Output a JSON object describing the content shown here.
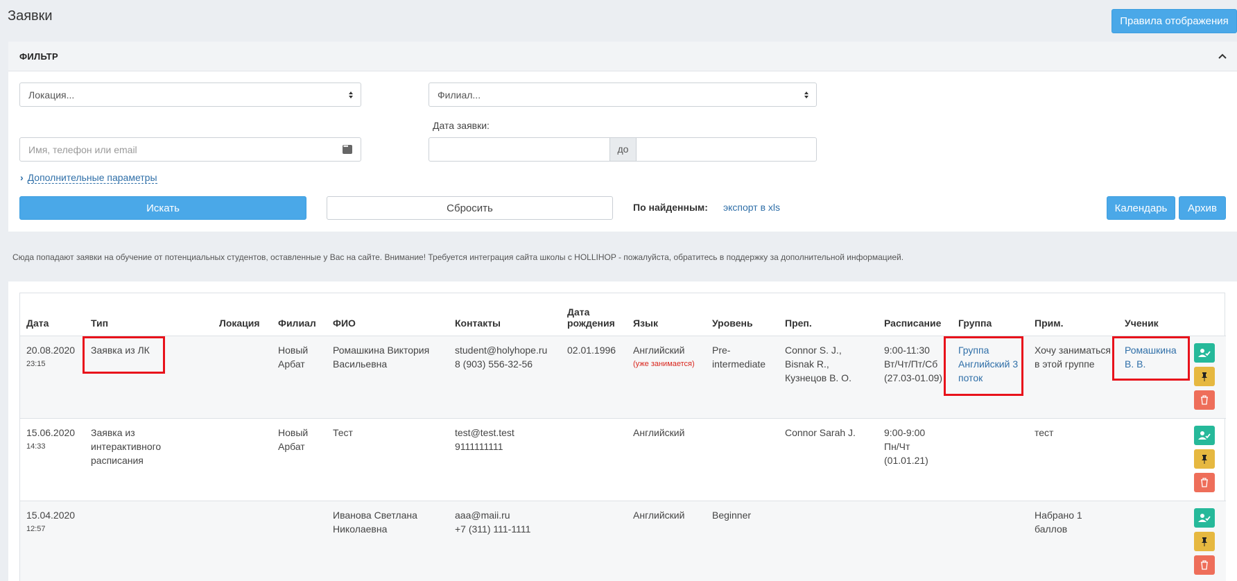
{
  "page": {
    "title": "Заявки",
    "rules_button": "Правила отображения"
  },
  "filter": {
    "title": "ФИЛЬТР",
    "location_select": "Локация...",
    "branch_select": "Филиал...",
    "search_placeholder": "Имя, телефон или email",
    "date_label": "Дата заявки:",
    "date_separator": "до",
    "more_params": "Дополнительные параметры",
    "search_button": "Искать",
    "reset_button": "Сбросить",
    "found_label": "По найденным:",
    "export_link": "экспорт в xls",
    "calendar_button": "Календарь",
    "archive_button": "Архив"
  },
  "notice": "Сюда попадают заявки на обучение от потенциальных студентов, оставленные у Вас на сайте. Внимание! Требуется интеграция сайта школы с HOLLIHOP - пожалуйста, обратитесь в поддержку за дополнительной информацией.",
  "table": {
    "headers": {
      "date": "Дата",
      "type": "Тип",
      "location": "Локация",
      "branch": "Филиал",
      "fio": "ФИО",
      "contacts": "Контакты",
      "birth_1": "Дата",
      "birth_2": "рождения",
      "language": "Язык",
      "level": "Уровень",
      "teacher": "Преп.",
      "schedule": "Расписание",
      "group": "Группа",
      "note": "Прим.",
      "student": "Ученик"
    },
    "rows": [
      {
        "date": "20.08.2020",
        "time": "23:15",
        "type": "Заявка из ЛК",
        "location": "",
        "branch": "Новый Арбат",
        "fio": "Ромашкина Виктория Васильевна",
        "email": "student@holyhope.ru",
        "phone": "8 (903) 556-32-56",
        "birth": "02.01.1996",
        "language": "Английский",
        "language_note": "(уже занимается)",
        "level": "Pre-intermediate",
        "teacher": "Connor S. J., Bisnak R., Кузнецов В. О.",
        "schedule_1": "9:00-11:30",
        "schedule_2": "Вт/Чт/Пт/Сб",
        "schedule_3": "(27.03-01.09)",
        "group": "Группа Английский 3 поток",
        "note": "Хочу заниматься в этой группе",
        "student": "Ромашкина В. В."
      },
      {
        "date": "15.06.2020",
        "time": "14:33",
        "type": "Заявка из интерактивного расписания",
        "location": "",
        "branch": "Новый Арбат",
        "fio": "Тест",
        "email": "test@test.test",
        "phone": "9111111111",
        "birth": "",
        "language": "Английский",
        "language_note": "",
        "level": "",
        "teacher": "Connor Sarah J.",
        "schedule_1": "9:00-9:00",
        "schedule_2": "Пн/Чт",
        "schedule_3": "(01.01.21)",
        "group": "",
        "note": "тест",
        "student": ""
      },
      {
        "date": "15.04.2020",
        "time": "12:57",
        "type": "",
        "location": "",
        "branch": "",
        "fio": "Иванова Светлана Николаевна",
        "email": "aaa@maii.ru",
        "phone": "+7 (311) 111-1111",
        "birth": "",
        "language": "Английский",
        "language_note": "",
        "level": "Beginner",
        "teacher": "",
        "schedule_1": "",
        "schedule_2": "",
        "schedule_3": "",
        "group": "",
        "note": "Набрано 1 баллов",
        "student": ""
      }
    ]
  },
  "colors": {
    "accent_blue": "#4aa8e8",
    "link": "#2f6fa8",
    "action_green": "#26b99a",
    "action_yellow": "#e6b840",
    "action_red": "#ee6e5a",
    "highlight_red": "#e8121b"
  },
  "icons": [
    "chevron-up-icon",
    "sort-arrows-icon",
    "contact-card-icon",
    "chevron-right-icon",
    "add-user-icon",
    "pin-icon",
    "trash-icon"
  ]
}
